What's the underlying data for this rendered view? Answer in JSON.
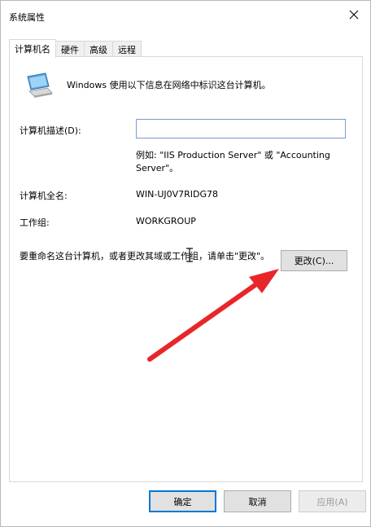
{
  "window": {
    "title": "系统属性"
  },
  "tabs": [
    {
      "label": "计算机名",
      "active": true
    },
    {
      "label": "硬件",
      "active": false
    },
    {
      "label": "高级",
      "active": false
    },
    {
      "label": "远程",
      "active": false
    }
  ],
  "panel": {
    "intro": "Windows 使用以下信息在网络中标识这台计算机。",
    "description_label": "计算机描述(D):",
    "description_value": "",
    "example_text": "例如: \"IIS Production Server\" 或 \"Accounting Server\"。",
    "full_name_label": "计算机全名:",
    "full_name_value": "WIN-UJ0V7RIDG78",
    "workgroup_label": "工作组:",
    "workgroup_value": "WORKGROUP",
    "rename_text": "要重命名这台计算机，或者更改其域或工作组，请单击\"更改\"。",
    "change_button": "更改(C)..."
  },
  "buttons": {
    "ok": "确定",
    "cancel": "取消",
    "apply": "应用(A)"
  },
  "colors": {
    "accent": "#0078d7",
    "arrow": "#e8262a"
  },
  "icons": {
    "close": "close-icon",
    "computer": "computer-icon"
  }
}
